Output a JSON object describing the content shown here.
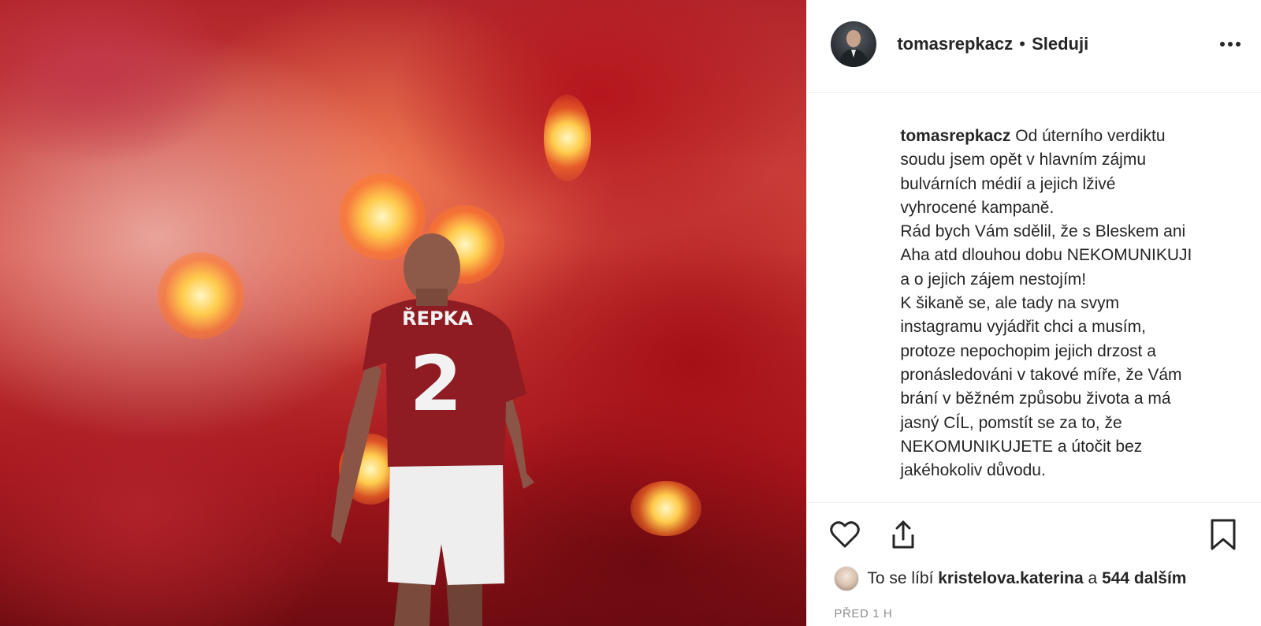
{
  "post": {
    "author": {
      "username": "tomasrepkacz",
      "separator": "•",
      "follow_state": "Sleduji"
    },
    "caption": {
      "username": "tomasrepkacz",
      "lines": [
        "Od úterního verdiktu",
        "soudu jsem opět v hlavním zájmu",
        "bulvárních médií a jejich lživé",
        "vyhrocené kampaně.",
        "Rád bych Vám sdělil, že s Bleskem ani",
        "Aha atd dlouhou dobu NEKOMUNIKUJI",
        "a o jejich zájem nestojím!",
        "K šikaně se, ale tady na svym",
        "instagramu vyjádřit chci a musím,",
        "protoze nepochopim jejich drzost a",
        "pronásledováni v takové míře, že Vám",
        "brání v běžném způsobu života a má",
        "jasný CÍL, pomstít se za to, že",
        "NEKOMUNIKUJETE a útočit bez",
        "jakéhokoliv důvodu."
      ]
    },
    "photo": {
      "jersey_name": "ŘEPKA",
      "jersey_number": "2"
    },
    "likes": {
      "prefix": "To se líbí",
      "first_liker": "kristelova.katerina",
      "connector": "a",
      "others": "544 dalším"
    },
    "timestamp": "PŘED 1 H",
    "icons": {
      "more": "more-options-icon",
      "like": "heart-icon",
      "share": "share-icon",
      "save": "bookmark-icon"
    },
    "colors": {
      "text": "#262626",
      "muted": "#8e8e8e",
      "border": "#efefef"
    }
  }
}
